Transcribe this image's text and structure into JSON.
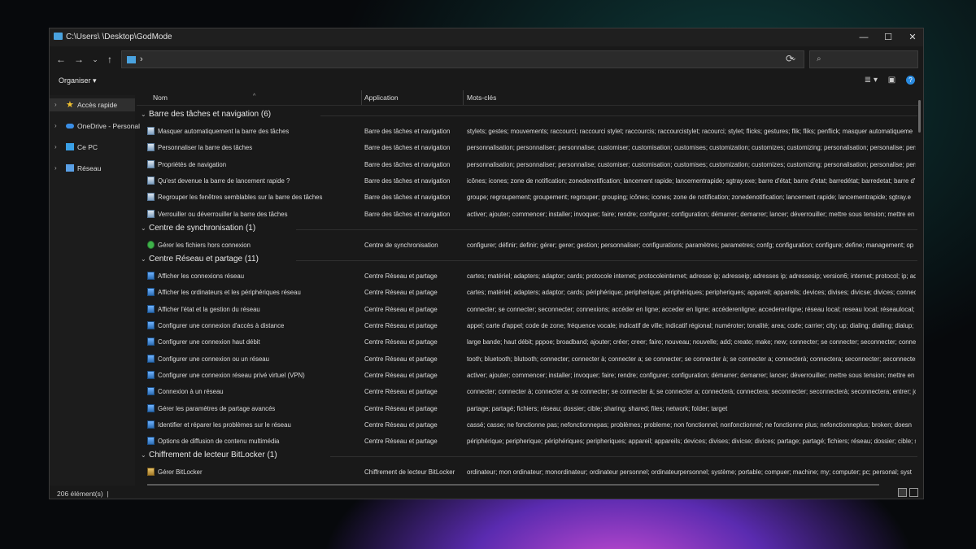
{
  "window": {
    "title": "C:\\Users\\            \\Desktop\\GodMode",
    "controls": {
      "minimize": "—",
      "maximize": "☐",
      "close": "✕"
    }
  },
  "address_bar": {
    "path": "›",
    "dropdown": "⌄",
    "refresh": "⟳",
    "search_icon": "⌕",
    "search_placeholder": ""
  },
  "nav": {
    "back": "←",
    "forward": "→",
    "recent": "⌄",
    "up": "↑"
  },
  "command_bar": {
    "organize": "Organiser ▾",
    "view_icon": "≣ ▾",
    "pane_icon": "▣",
    "help": "?"
  },
  "sidebar": {
    "items": [
      {
        "label": "Accès rapide",
        "icon": "star-icon",
        "color": "#f2c230",
        "selected": true
      },
      {
        "label": "OneDrive - Personal",
        "icon": "cloud-icon",
        "color": "#3a8ee6",
        "selected": false
      },
      {
        "label": "Ce PC",
        "icon": "computer-icon",
        "color": "#3aa0e6",
        "selected": false
      },
      {
        "label": "Réseau",
        "icon": "network-icon",
        "color": "#5aa0e6",
        "selected": false
      }
    ]
  },
  "columns": {
    "name": "Nom",
    "app": "Application",
    "keywords": "Mots-clés"
  },
  "groups": [
    {
      "title": "Barre des tâches et navigation (6)",
      "items": [
        {
          "name": "Masquer automatiquement la barre des tâches",
          "app": "Barre des tâches et navigation",
          "kw": "stylets; gestes; mouvements; raccourci; raccourci stylet; raccourcis; raccourcistylet; racourci; stylet; flicks; gestures; flik; fliks; penflick; masquer automatiqueme",
          "icon": "doc"
        },
        {
          "name": "Personnaliser la barre des tâches",
          "app": "Barre des tâches et navigation",
          "kw": "personnalisation; personnaliser; personnalise; customiser; customisation; customises; customization; customizes; customizing; personalisation; personalise; pers",
          "icon": "doc"
        },
        {
          "name": "Propriétés de navigation",
          "app": "Barre des tâches et navigation",
          "kw": "personnalisation; personnaliser; personnalise; customiser; customisation; customises; customization; customizes; customizing; personalisation; personalise; pers",
          "icon": "doc"
        },
        {
          "name": "Qu'est devenue la barre de lancement rapide ?",
          "app": "Barre des tâches et navigation",
          "kw": "icônes; icones; zone de notification; zonedenotification; lancement rapide; lancementrapide; sgtray.exe; barre d'état; barre d'etat; barredétat; barredetat; barre d'",
          "icon": "doc"
        },
        {
          "name": "Regrouper les fenêtres semblables sur la barre des tâches",
          "app": "Barre des tâches et navigation",
          "kw": "groupe; regroupement; groupement; regrouper; grouping; icônes; icones; zone de notification; zonedenotification; lancement rapide; lancementrapide; sgtray.e",
          "icon": "doc"
        },
        {
          "name": "Verrouiller ou déverrouiller la barre des tâches",
          "app": "Barre des tâches et navigation",
          "kw": "activer; ajouter; commencer; installer; invoquer; faire; rendre; configurer; configuration; démarrer; demarrer; lancer; déverrouiller; mettre sous tension; mettre en",
          "icon": "doc"
        }
      ]
    },
    {
      "title": "Centre de synchronisation (1)",
      "items": [
        {
          "name": "Gérer les fichiers hors connexion",
          "app": "Centre de synchronisation",
          "kw": "configurer; définir; definir; gérer; gerer; gestion; personnaliser; configurations; paramètres; parametres; confg; configuration; configure; define; management; op",
          "icon": "sync"
        }
      ]
    },
    {
      "title": "Centre Réseau et partage (11)",
      "items": [
        {
          "name": "Afficher les connexions réseau",
          "app": "Centre Réseau et partage",
          "kw": "cartes; matériel; adapters; adaptor; cards; protocole internet; protocoleinternet; adresse ip; adresseip; adresses ip; adressesip; version6; internet; protocol; ip; addr",
          "icon": "net"
        },
        {
          "name": "Afficher les ordinateurs et les périphériques réseau",
          "app": "Centre Réseau et partage",
          "kw": "cartes; matériel; adapters; adaptor; cards; périphérique; peripherique; périphériques; peripheriques; appareil; appareils; devices; divises; divicse; divices; connecte",
          "icon": "net"
        },
        {
          "name": "Afficher l'état et la gestion du réseau",
          "app": "Centre Réseau et partage",
          "kw": "connecter; se connecter; seconnecter; connexions; accéder en ligne; acceder en ligne; accéderenligne; accederenligne; réseau local; reseau local; réseaulocal; res",
          "icon": "net"
        },
        {
          "name": "Configurer une connexion d'accès à distance",
          "app": "Centre Réseau et partage",
          "kw": "appel; carte d'appel; code de zone; fréquence vocale; indicatif de ville; indicatif régional; numéroter; tonalité; area; code; carrier; city; up; dialing; dialling; dialup;",
          "icon": "net"
        },
        {
          "name": "Configurer une connexion haut débit",
          "app": "Centre Réseau et partage",
          "kw": "large bande; haut débit; pppoe; broadband; ajouter; créer; creer; faire; nouveau; nouvelle; add; create; make; new; connecter; se connecter; seconnecter; connexi",
          "icon": "net"
        },
        {
          "name": "Configurer une connexion ou un réseau",
          "app": "Centre Réseau et partage",
          "kw": "tooth; bluetooth; blutooth; connecter; connecter à; connecter a; se connecter; se connecter à; se connecter a; connecterà; connectera; seconnecter; seconnecter",
          "icon": "net"
        },
        {
          "name": "Configurer une connexion réseau privé virtuel (VPN)",
          "app": "Centre Réseau et partage",
          "kw": "activer; ajouter; commencer; installer; invoquer; faire; rendre; configurer; configuration; démarrer; demarrer; lancer; déverrouiller; mettre sous tension; mettre en",
          "icon": "net"
        },
        {
          "name": "Connexion à un réseau",
          "app": "Centre Réseau et partage",
          "kw": "connecter; connecter à; connecter a; se connecter; se connecter à; se connecter a; connecterà; connectera; seconnecter; seconnecterà; seconnectera; entrer; join",
          "icon": "net"
        },
        {
          "name": "Gérer les paramètres de partage avancés",
          "app": "Centre Réseau et partage",
          "kw": "partage; partagé; fichiers; réseau; dossier; cible; sharing; shared; files; network; folder; target",
          "icon": "net"
        },
        {
          "name": "Identifier et réparer les problèmes sur le réseau",
          "app": "Centre Réseau et partage",
          "kw": "cassé; casse; ne fonctionne pas; nefonctionnepas; problèmes; probleme; non fonctionnel; nonfonctionnel; ne fonctionne plus; nefonctionneplus; broken; doesn",
          "icon": "net"
        },
        {
          "name": "Options de diffusion de contenu multimédia",
          "app": "Centre Réseau et partage",
          "kw": "périphérique; peripherique; périphériques; peripheriques; appareil; appareils; devices; divises; divicse; divices; partage; partagé; fichiers; réseau; dossier; cible; sha",
          "icon": "net"
        }
      ]
    },
    {
      "title": "Chiffrement de lecteur BitLocker (1)",
      "items": [
        {
          "name": "Gérer BitLocker",
          "app": "Chiffrement de lecteur BitLocker",
          "kw": "ordinateur; mon ordinateur; monordinateur; ordinateur personnel; ordinateurpersonnel; système; portable; compuer; machine; my; computer; pc; personal; syst",
          "icon": "bl"
        }
      ]
    }
  ],
  "status": {
    "count": "206 élément(s)",
    "sep": "|"
  }
}
